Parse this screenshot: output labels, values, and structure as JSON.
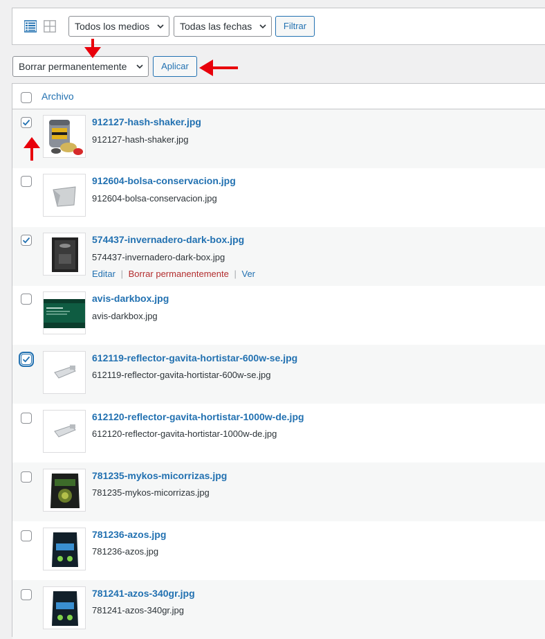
{
  "toolbar": {
    "media_filter": "Todos los medios",
    "date_filter": "Todas las fechas",
    "filter_button": "Filtrar",
    "bulk_action": "Borrar permanentemente",
    "apply_button": "Aplicar",
    "view_modes": [
      "list-view-icon",
      "grid-view-icon"
    ]
  },
  "table": {
    "header": "Archivo",
    "rows": [
      {
        "title": "912127-hash-shaker.jpg",
        "filename": "912127-hash-shaker.jpg",
        "checked": true
      },
      {
        "title": "912604-bolsa-conservacion.jpg",
        "filename": "912604-bolsa-conservacion.jpg",
        "checked": false
      },
      {
        "title": "574437-invernadero-dark-box.jpg",
        "filename": "574437-invernadero-dark-box.jpg",
        "checked": true,
        "row_actions": {
          "edit": "Editar",
          "sep1": "|",
          "delete": "Borrar permanentemente",
          "sep2": "|",
          "view": "Ver"
        }
      },
      {
        "title": "avis-darkbox.jpg",
        "filename": "avis-darkbox.jpg",
        "checked": false
      },
      {
        "title": "612119-reflector-gavita-hortistar-600w-se.jpg",
        "filename": "612119-reflector-gavita-hortistar-600w-se.jpg",
        "checked": true
      },
      {
        "title": "612120-reflector-gavita-hortistar-1000w-de.jpg",
        "filename": "612120-reflector-gavita-hortistar-1000w-de.jpg",
        "checked": false
      },
      {
        "title": "781235-mykos-micorrizas.jpg",
        "filename": "781235-mykos-micorrizas.jpg",
        "checked": false
      },
      {
        "title": "781236-azos.jpg",
        "filename": "781236-azos.jpg",
        "checked": false
      },
      {
        "title": "781241-azos-340gr.jpg",
        "filename": "781241-azos-340gr.jpg",
        "checked": false
      }
    ]
  },
  "colors": {
    "link": "#2271b1",
    "delete": "#b32d2e",
    "annotation_arrow": "#e8000b"
  }
}
